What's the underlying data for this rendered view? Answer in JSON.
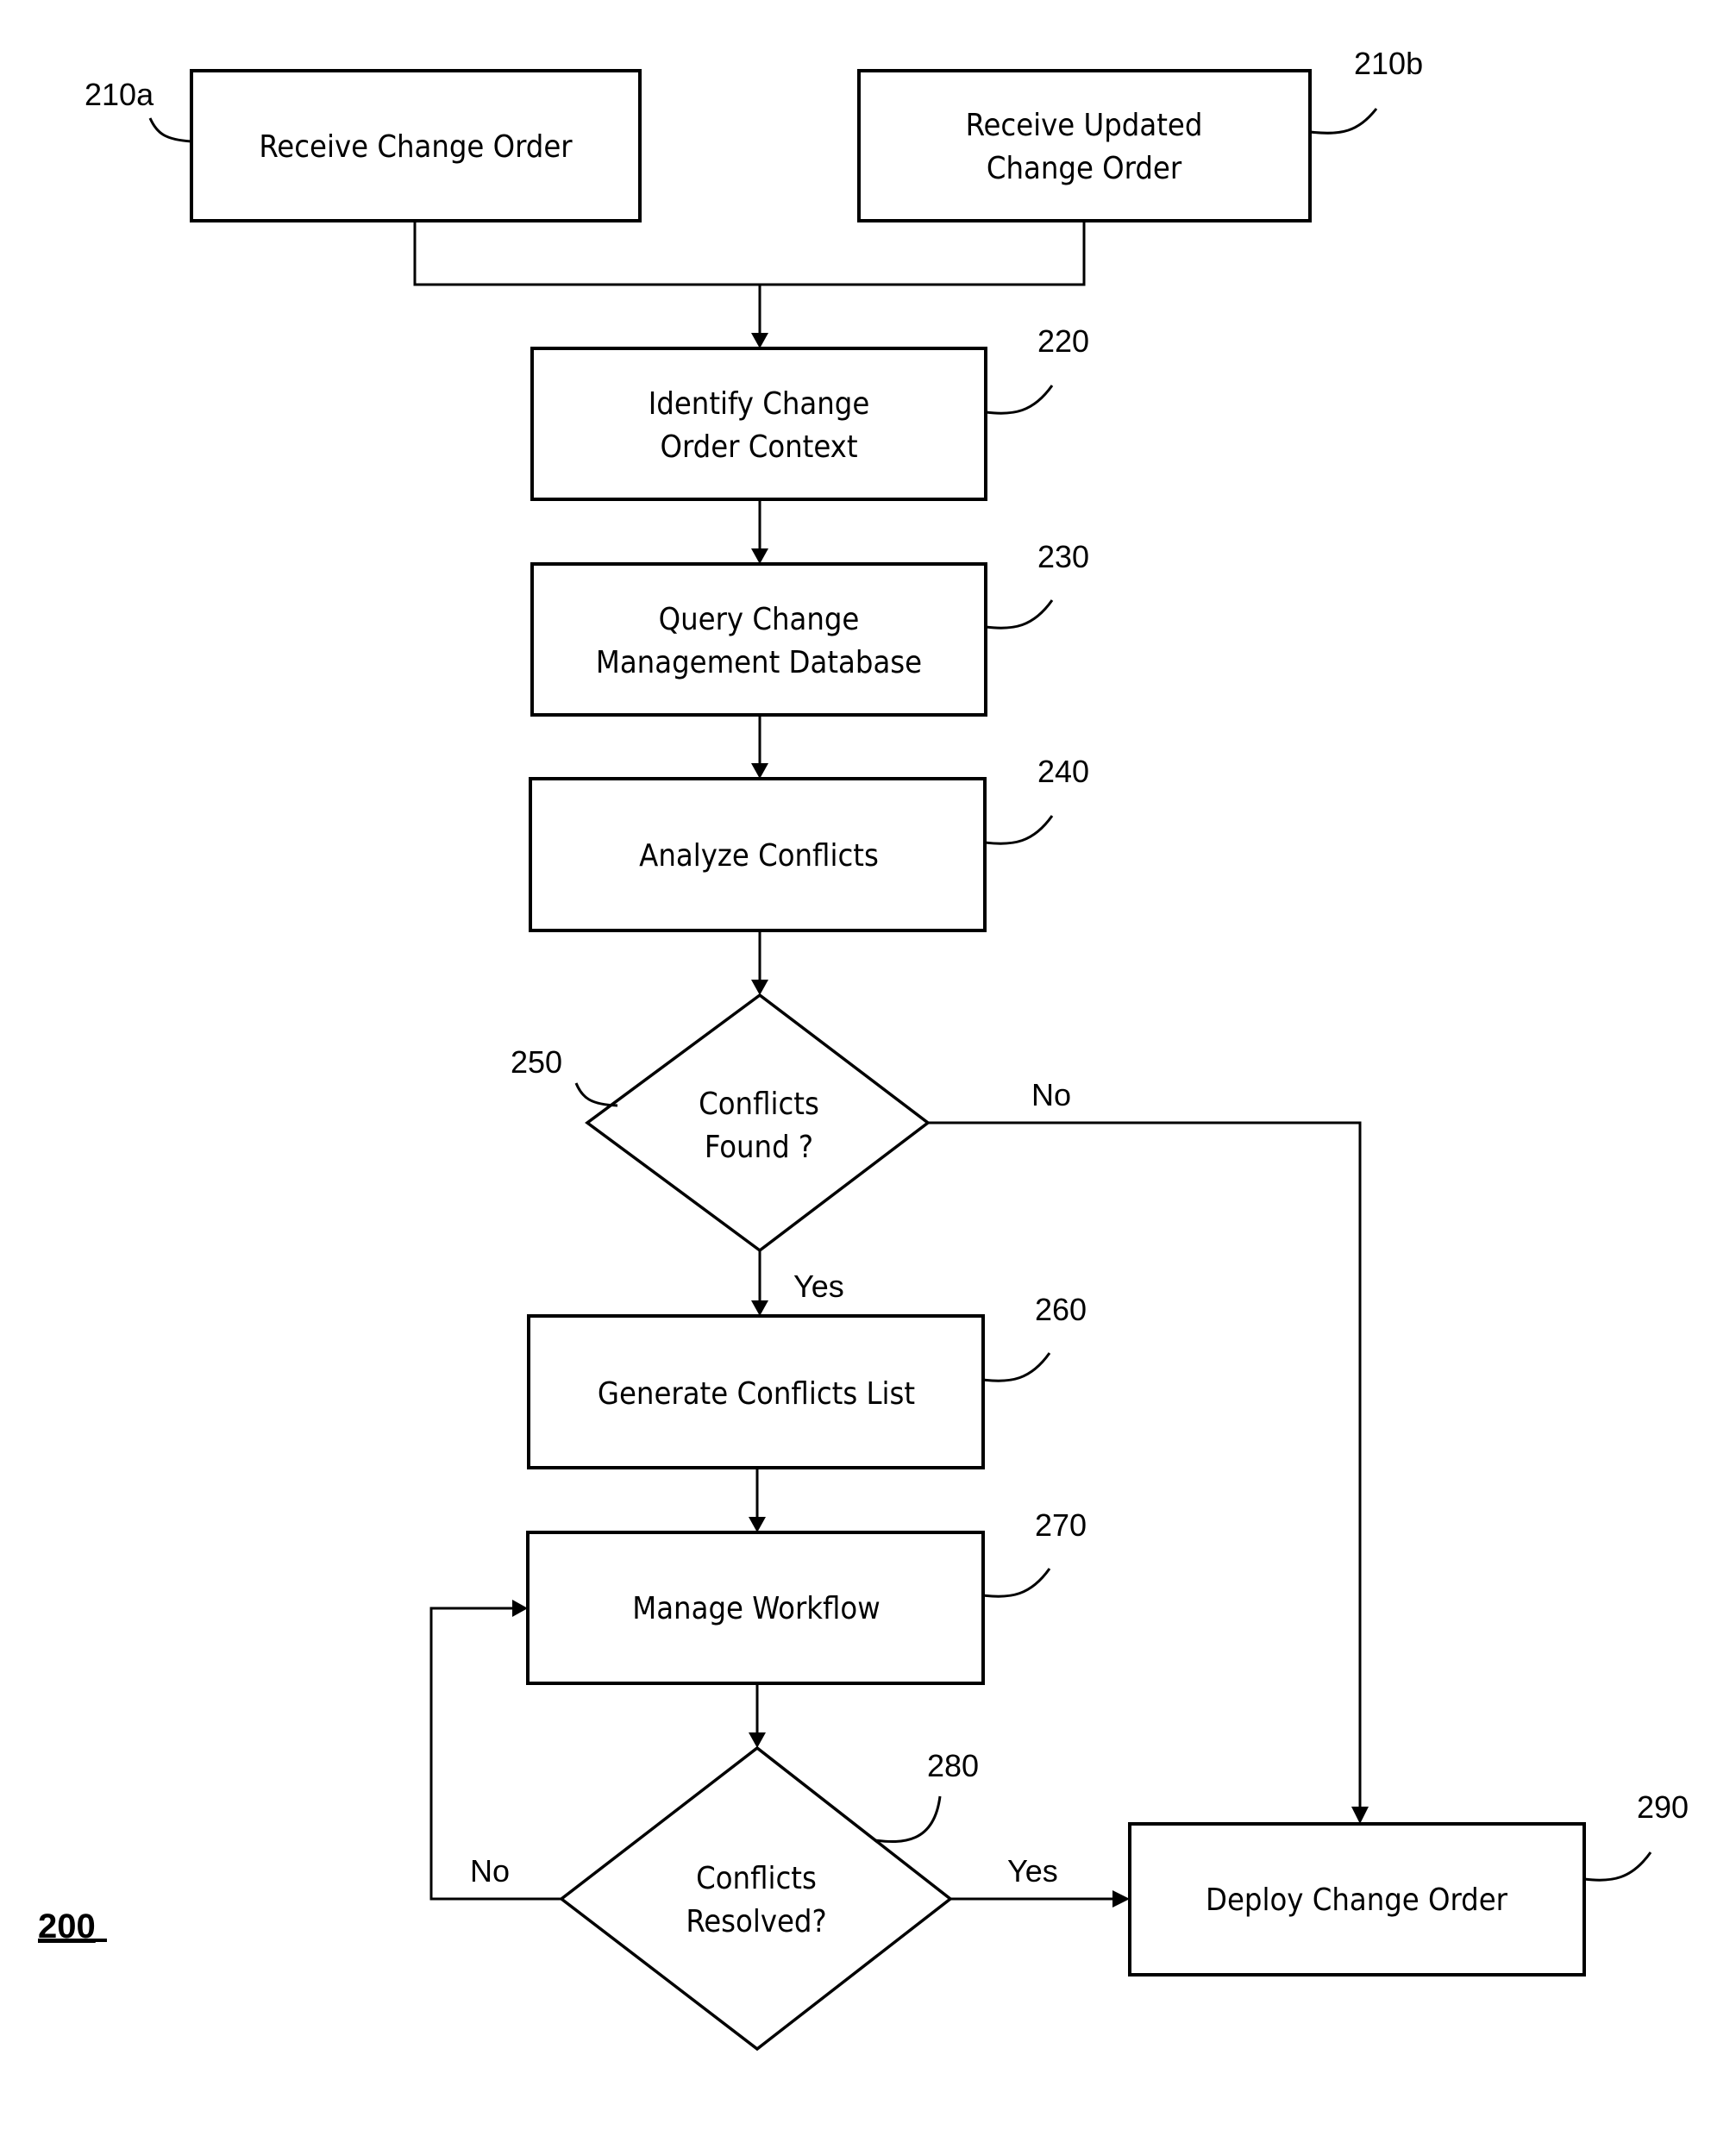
{
  "figure": {
    "number": "200",
    "type": "flowchart"
  },
  "nodes": {
    "n210a": {
      "ref": "210a",
      "shape": "process",
      "lines": [
        "Receive Change Order"
      ]
    },
    "n210b": {
      "ref": "210b",
      "shape": "process",
      "lines": [
        "Receive Updated",
        "Change Order"
      ]
    },
    "n220": {
      "ref": "220",
      "shape": "process",
      "lines": [
        "Identify Change",
        "Order Context"
      ]
    },
    "n230": {
      "ref": "230",
      "shape": "process",
      "lines": [
        "Query Change",
        "Management Database"
      ]
    },
    "n240": {
      "ref": "240",
      "shape": "process",
      "lines": [
        "Analyze Conflicts"
      ]
    },
    "n250": {
      "ref": "250",
      "shape": "decision",
      "lines": [
        "Conflicts",
        "Found ?"
      ]
    },
    "n260": {
      "ref": "260",
      "shape": "process",
      "lines": [
        "Generate Conflicts List"
      ]
    },
    "n270": {
      "ref": "270",
      "shape": "process",
      "lines": [
        "Manage Workflow"
      ]
    },
    "n280": {
      "ref": "280",
      "shape": "decision",
      "lines": [
        "Conflicts",
        "Resolved?"
      ]
    },
    "n290": {
      "ref": "290",
      "shape": "process",
      "lines": [
        "Deploy Change Order"
      ]
    }
  },
  "edges": [
    {
      "from": "210a",
      "to": "220",
      "label": ""
    },
    {
      "from": "210b",
      "to": "220",
      "label": ""
    },
    {
      "from": "220",
      "to": "230",
      "label": ""
    },
    {
      "from": "230",
      "to": "240",
      "label": ""
    },
    {
      "from": "240",
      "to": "250",
      "label": ""
    },
    {
      "from": "250",
      "to": "260",
      "label": "Yes"
    },
    {
      "from": "250",
      "to": "290",
      "label": "No"
    },
    {
      "from": "260",
      "to": "270",
      "label": ""
    },
    {
      "from": "270",
      "to": "280",
      "label": ""
    },
    {
      "from": "280",
      "to": "290",
      "label": "Yes"
    },
    {
      "from": "280",
      "to": "270",
      "label": "No"
    }
  ],
  "edge_labels": {
    "e250_yes": "Yes",
    "e250_no": "No",
    "e280_yes": "Yes",
    "e280_no": "No"
  }
}
